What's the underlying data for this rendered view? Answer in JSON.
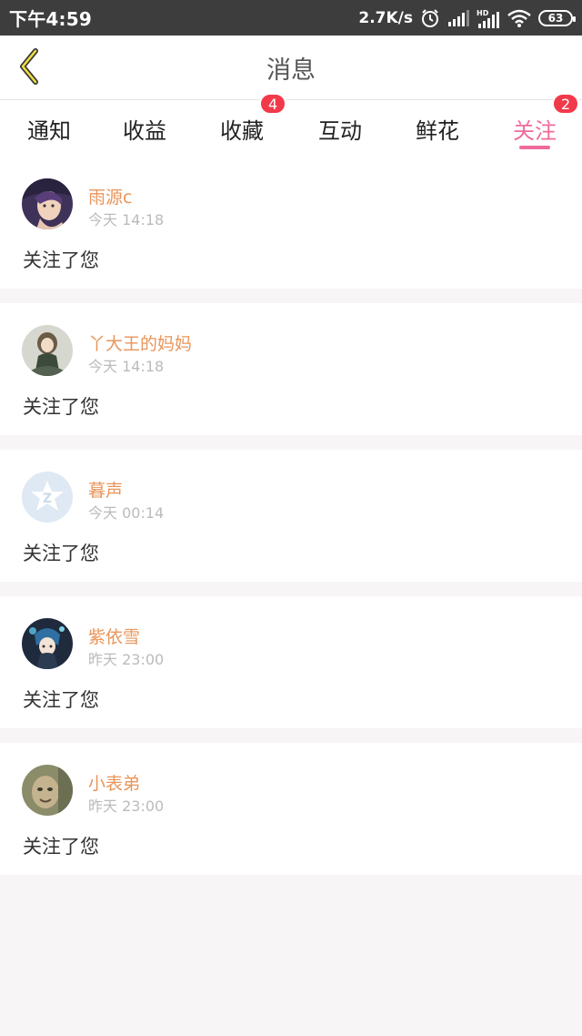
{
  "status_bar": {
    "time": "下午4:59",
    "speed": "2.7K/s",
    "battery": "63",
    "icons": [
      "alarm-icon",
      "signal-icon",
      "hd-signal-icon",
      "wifi-icon",
      "battery-icon"
    ]
  },
  "header": {
    "back_icon": "chevron-left-icon",
    "title": "消息"
  },
  "tabs": [
    {
      "label": "通知",
      "badge": null,
      "active": false
    },
    {
      "label": "收益",
      "badge": null,
      "active": false
    },
    {
      "label": "收藏",
      "badge": "4",
      "active": false
    },
    {
      "label": "互动",
      "badge": null,
      "active": false
    },
    {
      "label": "鲜花",
      "badge": null,
      "active": false
    },
    {
      "label": "关注",
      "badge": "2",
      "active": true
    }
  ],
  "notifications": [
    {
      "name": "雨源c",
      "time": "今天 14:18",
      "message": "关注了您",
      "avatar": "anime-girl-avatar"
    },
    {
      "name": "丫大王的妈妈",
      "time": "今天 14:18",
      "message": "关注了您",
      "avatar": "anime-figure-avatar"
    },
    {
      "name": "暮声",
      "time": "今天 00:14",
      "message": "关注了您",
      "avatar": "default-qq-avatar"
    },
    {
      "name": "紫依雪",
      "time": "昨天 23:00",
      "message": "关注了您",
      "avatar": "anime-blue-avatar"
    },
    {
      "name": "小表弟",
      "time": "昨天 23:00",
      "message": "关注了您",
      "avatar": "photo-face-avatar"
    }
  ],
  "colors": {
    "accent": "#ef6b9c",
    "nickname": "#e9955a",
    "badge": "#f2394a",
    "status_bar": "#3d3d3d"
  }
}
